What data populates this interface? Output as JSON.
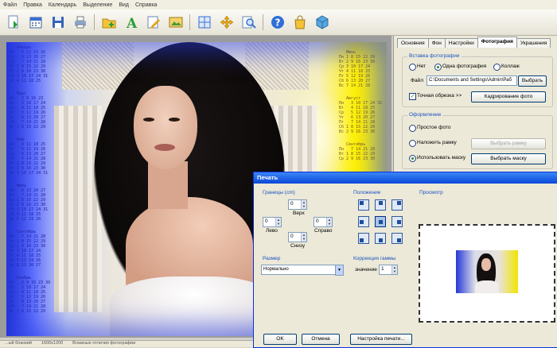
{
  "menu": [
    "Файл",
    "Правка",
    "Календарь",
    "Выделение",
    "Вид",
    "Справка"
  ],
  "toolbar_icons": [
    "new-document-icon",
    "calendar-icon",
    "save-icon",
    "print-icon",
    "add-image-icon",
    "text-icon",
    "edit-icon",
    "picture-icon",
    "grid-icon",
    "move-icon",
    "zoom-icon",
    "help-icon",
    "bag-icon",
    "package-icon"
  ],
  "right_panel": {
    "tabs": [
      "Основния",
      "Фон",
      "Настройки",
      "Фотография",
      "Украшения"
    ],
    "active_tab": "Фотография",
    "photo_group": {
      "title": "Вставка фотографии",
      "options": [
        "Нет",
        "Одна фотография",
        "Коллаж"
      ],
      "selected": "Одна фотография",
      "file_label": "Файл",
      "file_path": "C:\\Documents and Settings\\Admin\\Раб",
      "choose_button": "Выбрать",
      "crop_checkbox": "Точная обрезка >>",
      "crop_checked": true,
      "crop_button": "Кадрирование фото"
    },
    "design_group": {
      "title": "Оформление",
      "options": [
        "Простое фото",
        "Наложить рамку",
        "Использовать маску"
      ],
      "selected": "Использовать маску",
      "frame_button": "Выбрать рамку",
      "mask_button": "Выбрать маску"
    }
  },
  "print_dialog": {
    "title": "Печать",
    "margins": {
      "title": "Границы (cm)",
      "top_label": "Верх",
      "top": "0",
      "left_label": "Лево",
      "left": "0",
      "right_label": "Справо",
      "right": "0",
      "bottom_label": "Снизу",
      "bottom": "0"
    },
    "position_title": "Положение",
    "size": {
      "title": "Размер",
      "value": "Нормально"
    },
    "gamma": {
      "title": "Коррекция гаммы",
      "label": "значение",
      "value": "1"
    },
    "preview_title": "Просмотр",
    "ok": "OK",
    "cancel": "Отмена",
    "setup": "Настройка печати..."
  },
  "status": [
    "...ый бланкий",
    "1600x1200",
    "Влажные отличия фотографии"
  ],
  "calendar_left": [
    "   Январь\nПн   5 12 19 26\nВт   6 13 20 27\nСр   7 14 21 28\nЧт 1 8 15 22 29\nПт 2 9 16 23 30\nСб 3 10 17 24 31\nВс 4 11 18 25",
    "   Март\nПн   2 9 16 23\nВт   3 10 17 24\nСр   4 11 18 25\nЧт   5 12 19 26\nПт   6 13 20 27\nСб   7 14 21 28\nВс 1 8 15 22 29",
    "   Май\nПн   4 11 18 25\nВт   5 12 19 26\nСр   6 13 20 27\nЧт   7 14 21 28\nПт 1 8 15 22 29\nСб 2 9 16 23 30\nВс 3 10 17 24 31",
    "   Июль\nПн   6 13 20 27\nВт   7 14 21 28\nСр 1 8 15 22 29\nЧт 2 9 16 23 30\nПт 3 10 17 24 31\nСб 4 11 18 25\nВс 5 12 19 26",
    "   Сентябрь\nПн   7 14 21 28\nВт 1 8 15 22 29\nСр 2 9 16 23 30\nЧт 3 10 17 24\nПт 4 11 18 25\nСб 5 12 19 26\nВс 6 13 20 27",
    "   Ноябрь\nПн   2 9 16 23 30\nВт   3 10 17 24\nСр   4 11 18 25\nЧт   5 12 19 26\nПт   6 13 20 27\nСб   7 14 21 28\nВс 1 8 15 22 29"
  ],
  "calendar_right": [
    "   Июнь\nПн 1 8 15 22 29\nВт 2 9 16 23 30\nСр 3 10 17 24\nЧт 4 11 18 25\nПт 5 12 19 26\nСб 6 13 20 27\nВс 7 14 21 28",
    "   Август\nПн   3 10 17 24 31\nВт   4 11 18 25\nСр   5 12 19 26\nЧт   6 13 20 27\nПт   7 14 21 28\nСб 1 8 15 22 29\nВс 2 9 16 23 30",
    "   Сентябрь\nПн   7 14 21 28\nВт 1 8 15 22 29\nСр 2 9 16 23 30"
  ]
}
